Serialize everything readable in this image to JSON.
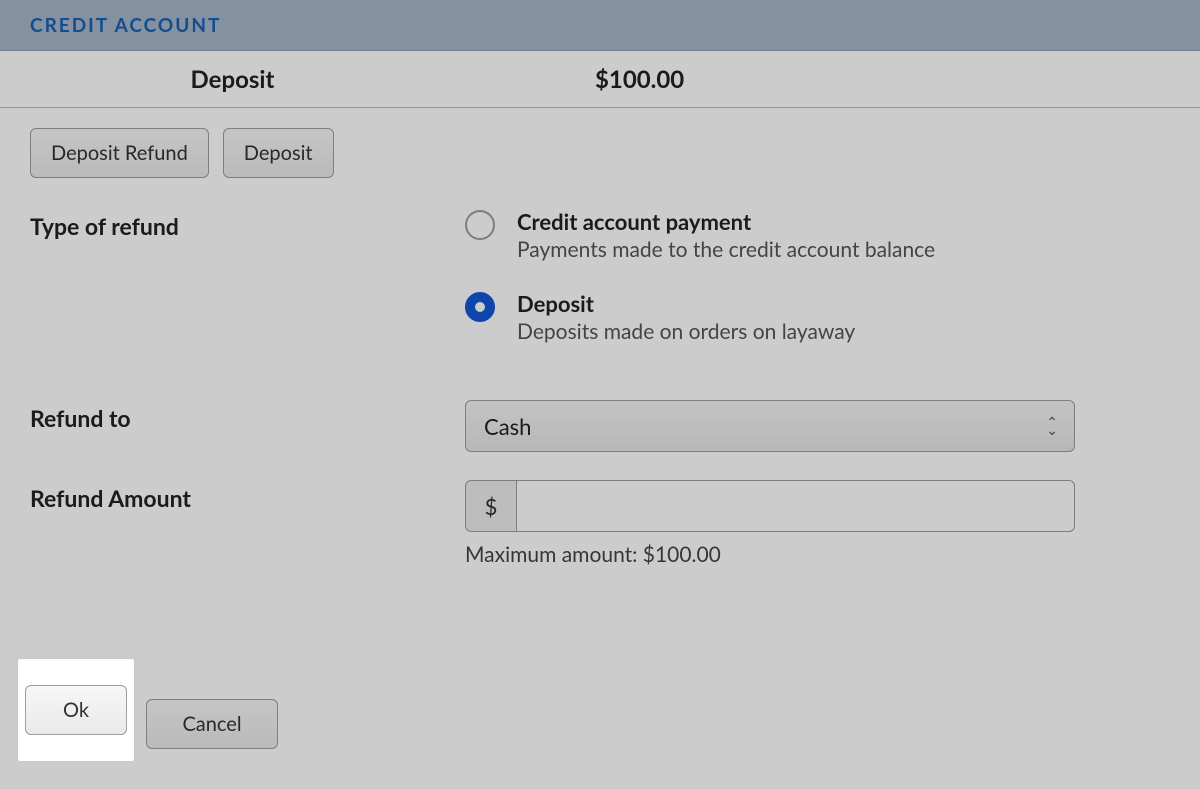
{
  "header": {
    "title": "CREDIT ACCOUNT"
  },
  "summary": {
    "type_label": "Deposit",
    "amount": "$100.00"
  },
  "tabs": {
    "deposit_refund": "Deposit Refund",
    "deposit": "Deposit"
  },
  "form": {
    "type_of_refund_label": "Type of refund",
    "refund_to_label": "Refund to",
    "refund_amount_label": "Refund Amount",
    "currency_symbol": "$",
    "max_amount_text": "Maximum amount: $100.00"
  },
  "refund_options": {
    "credit_payment": {
      "title": "Credit account payment",
      "desc": "Payments made to the credit account balance",
      "selected": false
    },
    "deposit": {
      "title": "Deposit",
      "desc": "Deposits made on orders on layaway",
      "selected": true
    }
  },
  "refund_to": {
    "selected": "Cash"
  },
  "refund_amount": {
    "value": ""
  },
  "footer": {
    "ok": "Ok",
    "cancel": "Cancel"
  }
}
